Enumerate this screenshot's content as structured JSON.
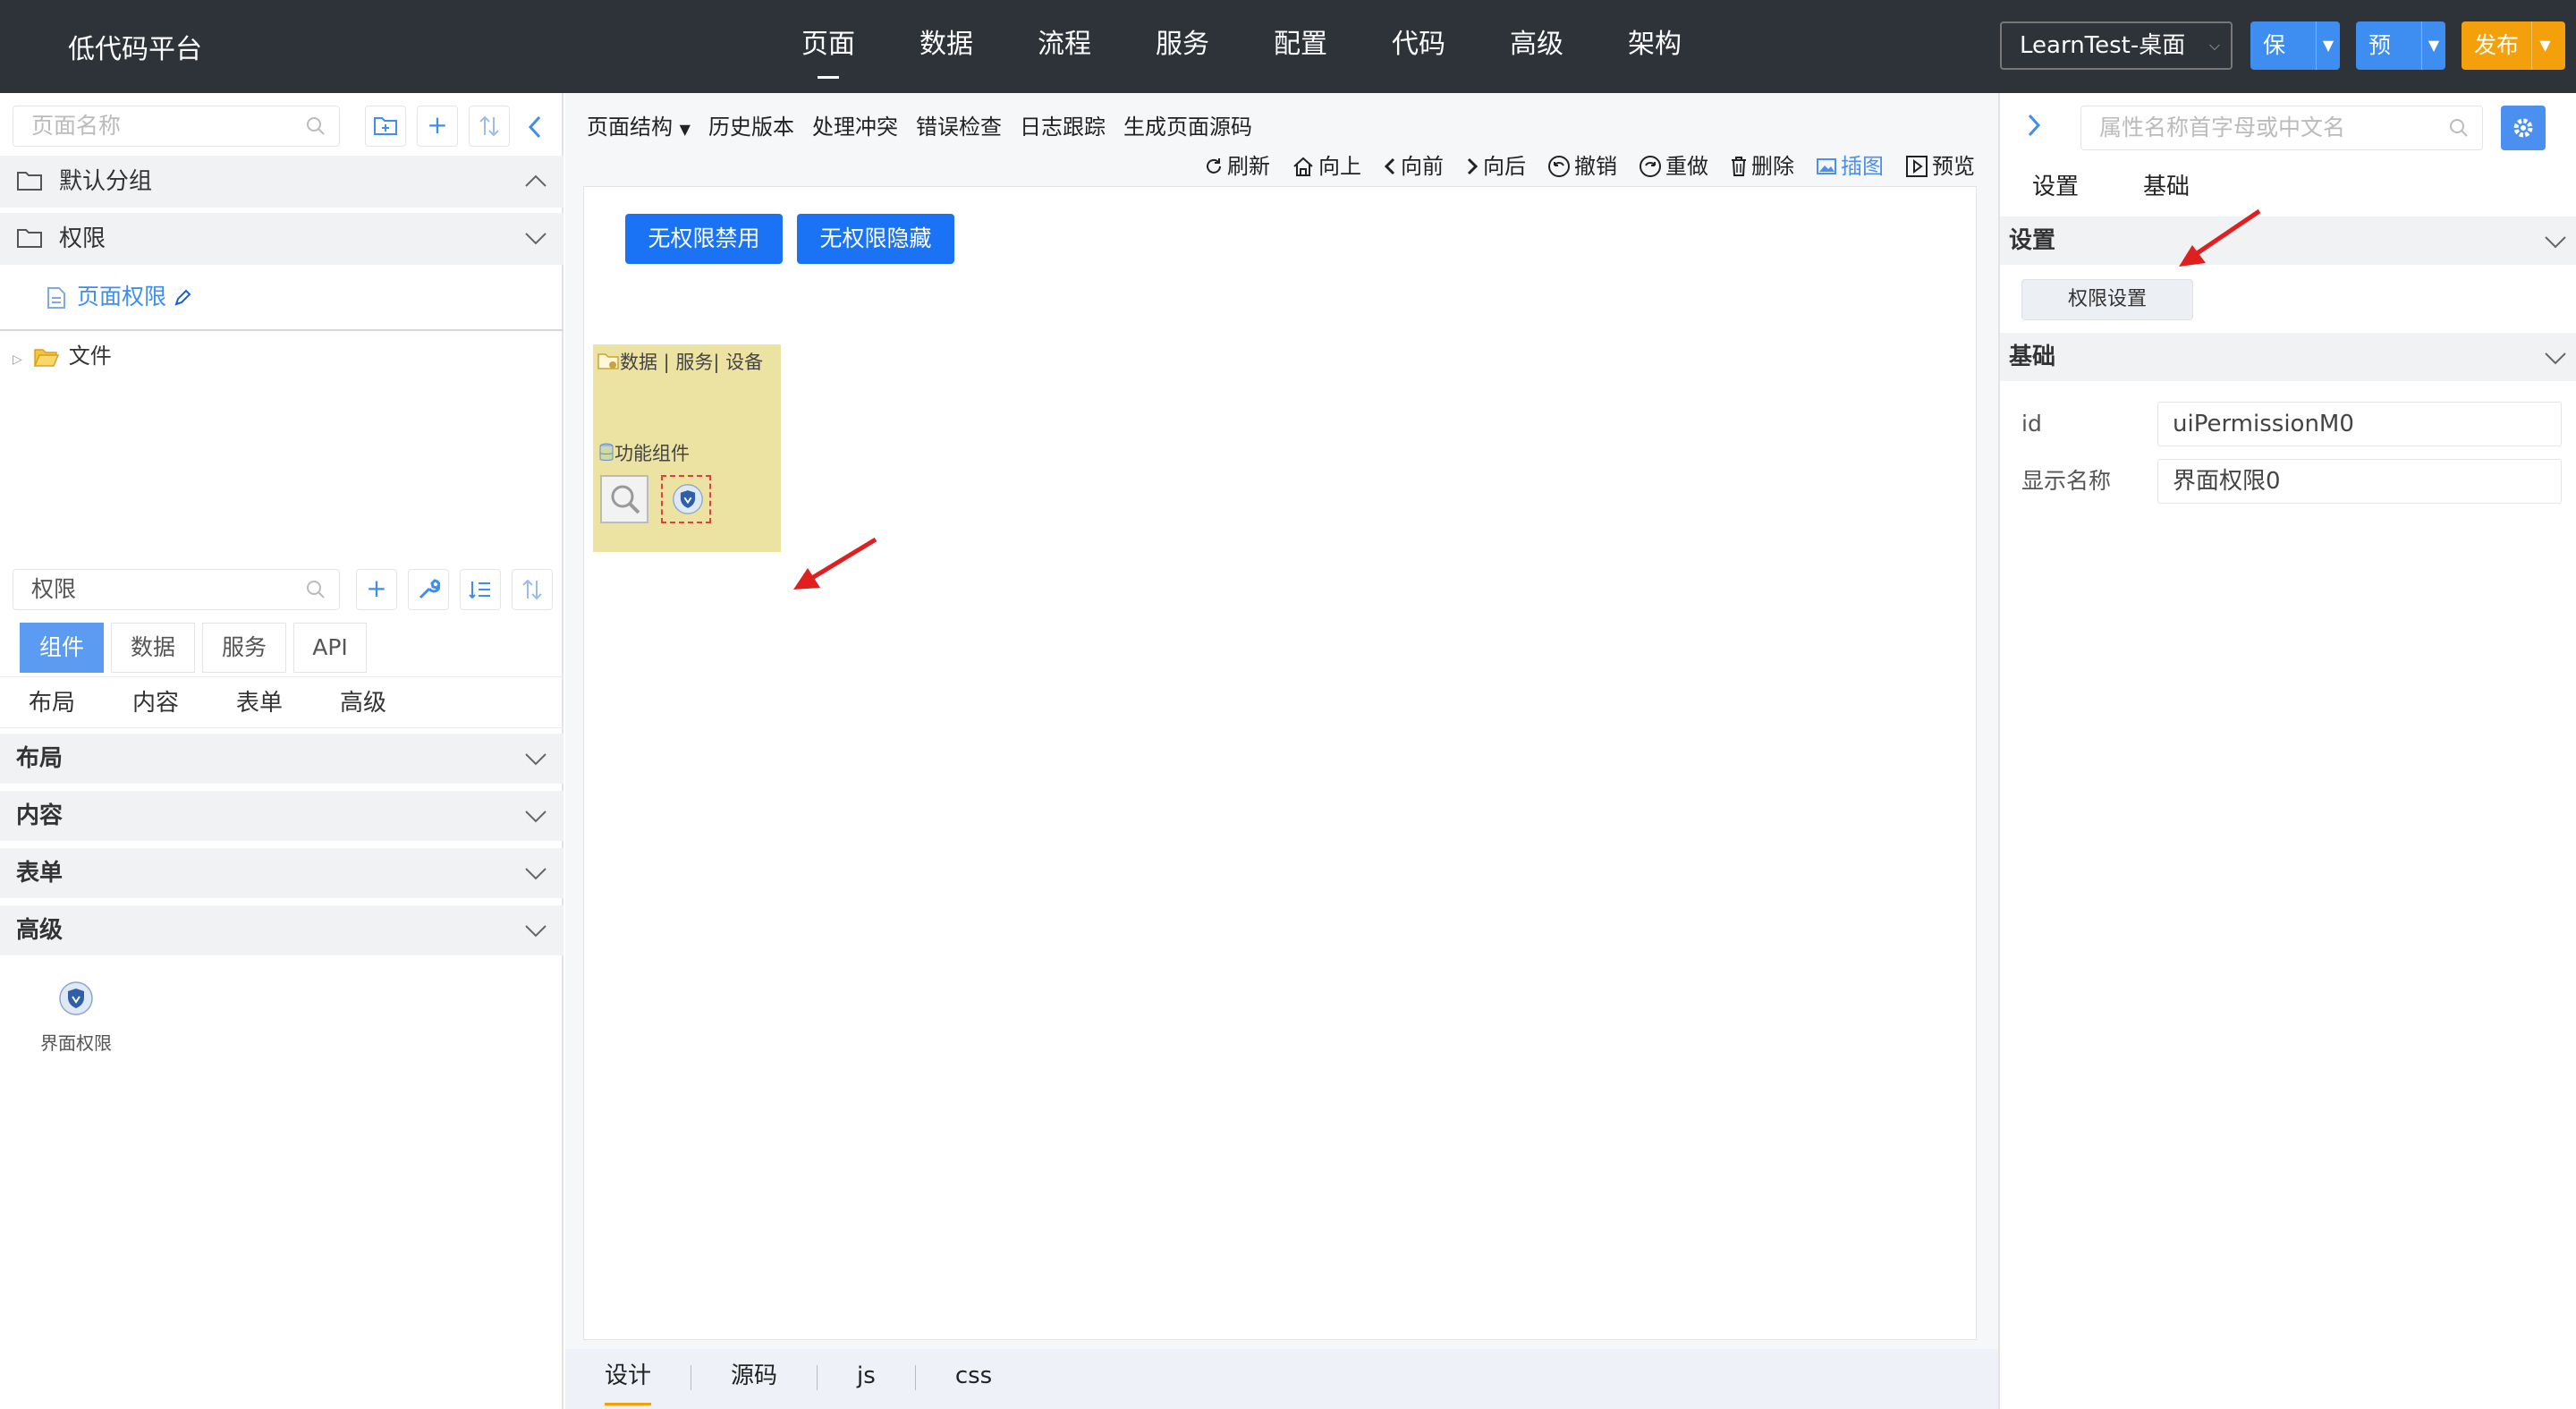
{
  "app": {
    "brand": "低代码平台",
    "nav": [
      "页面",
      "数据",
      "流程",
      "服务",
      "配置",
      "代码",
      "高级",
      "架构"
    ],
    "active_nav": "页面",
    "project": "LearnTest-桌面",
    "save": "保存",
    "preview": "预览",
    "publish": "发布"
  },
  "colors": {
    "topbar": "#2d3338",
    "primary": "#3d8ef0",
    "publish": "#f4a00b",
    "canvas_button": "#1a73f5",
    "component_box": "#ece3a2"
  },
  "left": {
    "page_search_placeholder": "页面名称",
    "groups": [
      "默认分组",
      "权限"
    ],
    "page_item": "页面权限",
    "tree_file": "文件",
    "component_search_value": "权限",
    "tabs": [
      "组件",
      "数据",
      "服务",
      "API"
    ],
    "subtabs": [
      "布局",
      "内容",
      "表单",
      "高级"
    ],
    "categories": [
      "布局",
      "内容",
      "表单",
      "高级"
    ],
    "widget_label": "界面权限"
  },
  "center": {
    "menu": [
      "页面结构",
      "历史版本",
      "处理冲突",
      "错误检查",
      "日志跟踪",
      "生成页面源码"
    ],
    "actions": [
      "刷新",
      "向上",
      "向前",
      "向后",
      "撤销",
      "重做",
      "删除",
      "插图",
      "预览"
    ],
    "buttons": [
      "无权限禁用",
      "无权限隐藏"
    ],
    "component_header": "数据 | 服务| 设备",
    "component_group": "功能组件",
    "bottom_tabs": [
      "设计",
      "源码",
      "js",
      "css"
    ]
  },
  "right": {
    "search_placeholder": "属性名称首字母或中文名",
    "tabs": [
      "设置",
      "基础"
    ],
    "section_settings": "设置",
    "perm_button": "权限设置",
    "section_basic": "基础",
    "props": [
      {
        "label": "id",
        "value": "uiPermissionM0"
      },
      {
        "label": "显示名称",
        "value": "界面权限0"
      }
    ]
  }
}
